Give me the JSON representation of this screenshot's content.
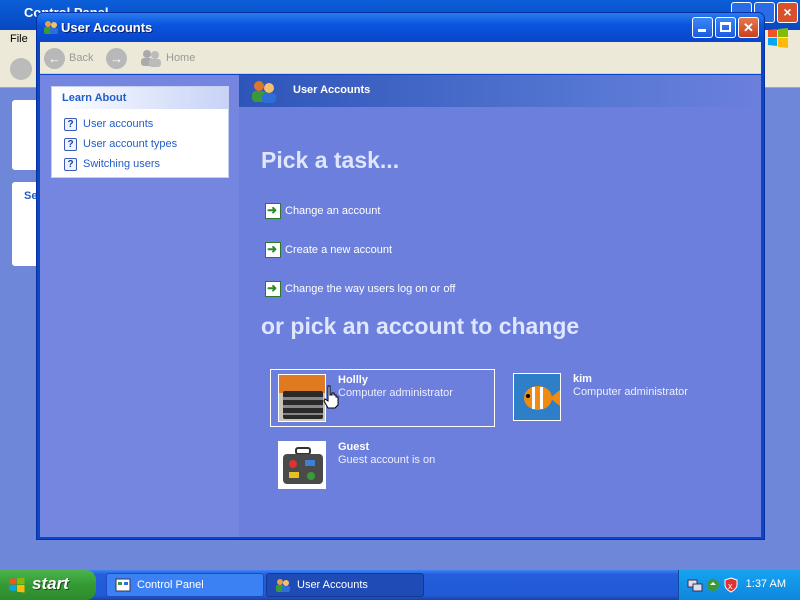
{
  "background_window": {
    "title": "Control Panel",
    "menu_file": "File",
    "side_label": "Se"
  },
  "window": {
    "title": "User Accounts"
  },
  "toolbar": {
    "back_label": "Back",
    "home_label": "Home"
  },
  "sidebar": {
    "learn_about": {
      "header": "Learn About",
      "items": [
        {
          "label": "User accounts"
        },
        {
          "label": "User account types"
        },
        {
          "label": "Switching users"
        }
      ]
    }
  },
  "main": {
    "header_title": "User Accounts",
    "pick_task_title": "Pick a task...",
    "tasks": [
      {
        "label": "Change an account"
      },
      {
        "label": "Create a new account"
      },
      {
        "label": "Change the way users log on or off"
      }
    ],
    "pick_account_title": "or pick an account to change",
    "accounts": [
      {
        "name": "Hollly",
        "type": "Computer administrator",
        "selected": true
      },
      {
        "name": "kim",
        "type": "Computer administrator",
        "selected": false
      },
      {
        "name": "Guest",
        "type": "Guest account is on",
        "selected": false
      }
    ]
  },
  "taskbar": {
    "start_label": "start",
    "buttons": [
      {
        "label": "Control Panel",
        "active": false
      },
      {
        "label": "User Accounts",
        "active": true
      }
    ],
    "clock": "1:37 AM"
  },
  "colors": {
    "title_blue": "#0a55de",
    "content_blue": "#6c7fdd",
    "link_blue": "#215dc6",
    "start_green": "#349a34"
  }
}
